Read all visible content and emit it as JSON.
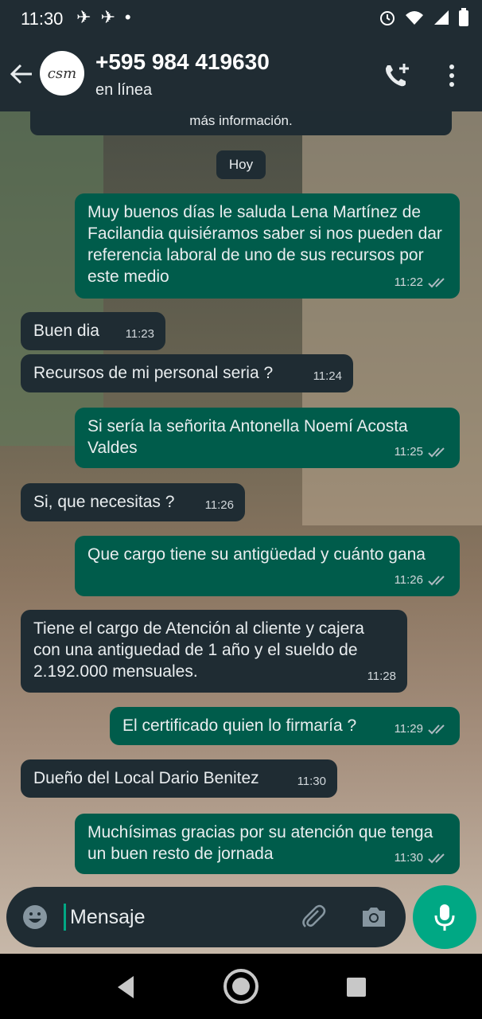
{
  "status_bar": {
    "time": "11:30",
    "icons": [
      "bird-icon",
      "bird-icon",
      "dot-icon"
    ],
    "right_icons": [
      "alarm-icon",
      "wifi-icon",
      "signal-icon",
      "battery-icon"
    ]
  },
  "header": {
    "avatar_text": "csm",
    "name": "+595 984 419630",
    "status": "en línea",
    "icons": [
      "back-arrow-icon",
      "add-call-icon",
      "more-icon"
    ]
  },
  "chat": {
    "info_banner": "más información.",
    "day_label": "Hoy",
    "messages": [
      {
        "direction": "out",
        "text": "Muy buenos días le saluda Lena Martínez de Facilandia quisiéramos saber si nos pueden dar referencia laboral de uno de sus recursos por este medio",
        "time": "11:22"
      },
      {
        "direction": "in",
        "text": "Buen dia",
        "time": "11:23"
      },
      {
        "direction": "in",
        "text": "Recursos de mi personal seria ?",
        "time": "11:24"
      },
      {
        "direction": "out",
        "text": "Si sería la señorita Antonella Noemí Acosta Valdes",
        "time": "11:25"
      },
      {
        "direction": "in",
        "text": "Si, que necesitas ?",
        "time": "11:26"
      },
      {
        "direction": "out",
        "text": "Que cargo tiene su antigüedad y cuánto gana",
        "time": "11:26"
      },
      {
        "direction": "in",
        "text": "Tiene el cargo de Atención al cliente y cajera con una antiguedad de 1 año y el sueldo de 2.192.000 mensuales.",
        "time": "11:28"
      },
      {
        "direction": "out",
        "text": "El certificado quien lo firmaría ?",
        "time": "11:29"
      },
      {
        "direction": "in",
        "text": "Dueño del Local Dario Benitez",
        "time": "11:30"
      },
      {
        "direction": "out",
        "text": "Muchísimas gracias por su atención que tenga un buen resto de jornada",
        "time": "11:30"
      }
    ]
  },
  "composer": {
    "placeholder": "Mensaje",
    "icons": [
      "emoji-icon",
      "attach-icon",
      "camera-icon",
      "mic-icon"
    ]
  },
  "colors": {
    "header": "#202c33",
    "outgoing": "#005c4b",
    "incoming": "#1f2c33",
    "accent": "#00a884"
  }
}
